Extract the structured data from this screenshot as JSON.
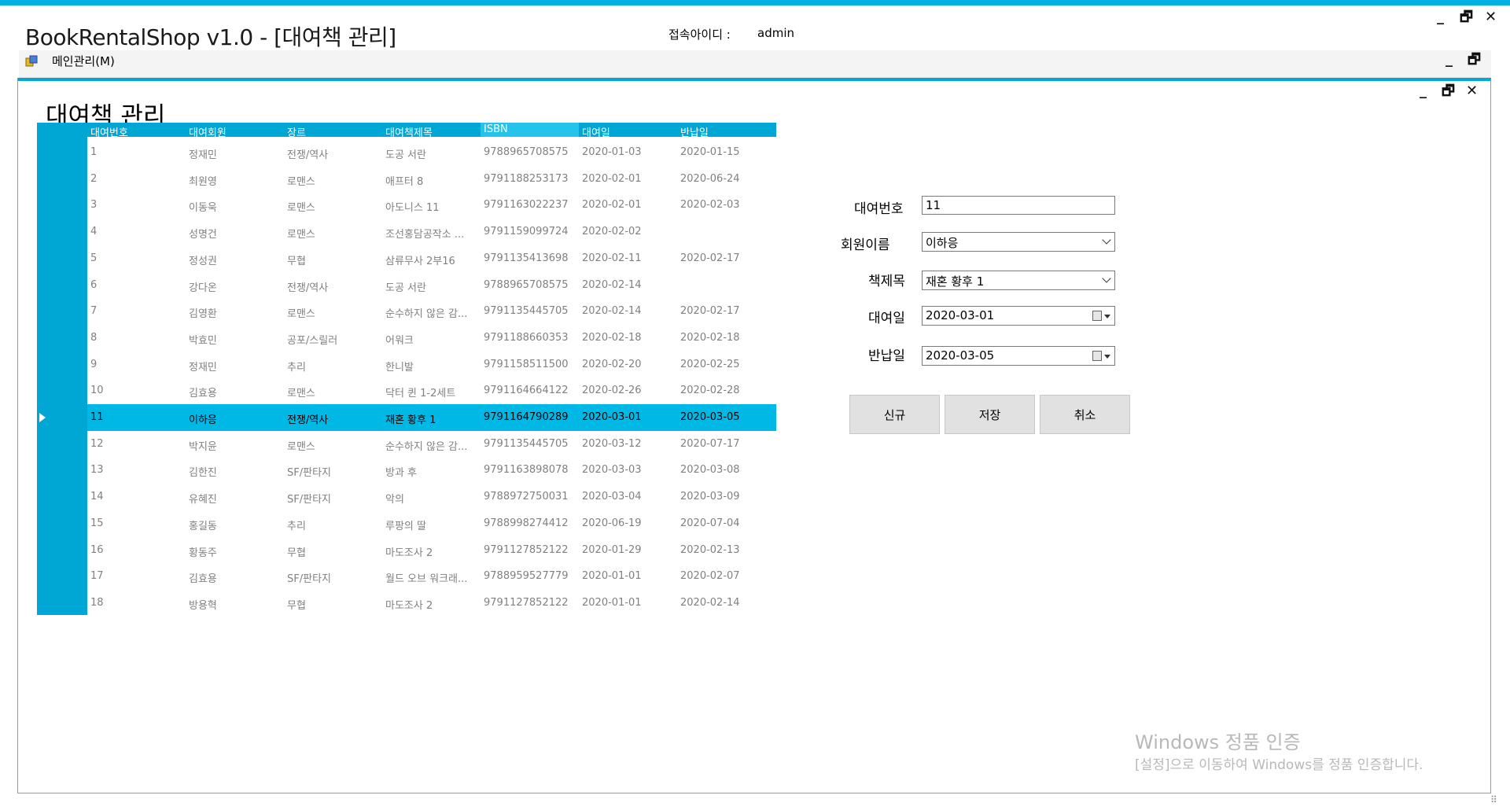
{
  "window": {
    "title": "BookRentalShop v1.0 - [대여책 관리]",
    "user_label": "접속아이디 :",
    "user_value": "admin"
  },
  "menubar": {
    "items": [
      {
        "label": "메인관리(M)"
      }
    ]
  },
  "form": {
    "title": "대여책 관리"
  },
  "grid": {
    "columns": [
      "대여번호",
      "대여회원",
      "장르",
      "대여책제목",
      "ISBN",
      "대여일",
      "반납일"
    ],
    "selected_row": 11,
    "rows": [
      {
        "no": "1",
        "member": "정재민",
        "genre": "전쟁/역사",
        "title": "도공 서란",
        "isbn": "9788965708575",
        "rent": "2020-01-03",
        "ret": "2020-01-15"
      },
      {
        "no": "2",
        "member": "최원영",
        "genre": "로맨스",
        "title": "애프터 8",
        "isbn": "9791188253173",
        "rent": "2020-02-01",
        "ret": "2020-06-24"
      },
      {
        "no": "3",
        "member": "이동욱",
        "genre": "로맨스",
        "title": "아도니스 11",
        "isbn": "9791163022237",
        "rent": "2020-02-01",
        "ret": "2020-02-03"
      },
      {
        "no": "4",
        "member": "성명건",
        "genre": "로맨스",
        "title": "조선홍담공작소 ...",
        "isbn": "9791159099724",
        "rent": "2020-02-02",
        "ret": ""
      },
      {
        "no": "5",
        "member": "정성권",
        "genre": "무협",
        "title": "삼류무사 2부16",
        "isbn": "9791135413698",
        "rent": "2020-02-11",
        "ret": "2020-02-17"
      },
      {
        "no": "6",
        "member": "강다온",
        "genre": "전쟁/역사",
        "title": "도공 서란",
        "isbn": "9788965708575",
        "rent": "2020-02-14",
        "ret": ""
      },
      {
        "no": "7",
        "member": "김영환",
        "genre": "로맨스",
        "title": "순수하지 않은 감...",
        "isbn": "9791135445705",
        "rent": "2020-02-14",
        "ret": "2020-02-17"
      },
      {
        "no": "8",
        "member": "박효민",
        "genre": "공포/스릴러",
        "title": "어워크",
        "isbn": "9791188660353",
        "rent": "2020-02-18",
        "ret": "2020-02-18"
      },
      {
        "no": "9",
        "member": "정재민",
        "genre": "추리",
        "title": "한니발",
        "isbn": "9791158511500",
        "rent": "2020-02-20",
        "ret": "2020-02-25"
      },
      {
        "no": "10",
        "member": "김효용",
        "genre": "로맨스",
        "title": "닥터 퀸 1-2세트",
        "isbn": "9791164664122",
        "rent": "2020-02-26",
        "ret": "2020-02-28"
      },
      {
        "no": "11",
        "member": "이하응",
        "genre": "전쟁/역사",
        "title": "재혼 황후 1",
        "isbn": "9791164790289",
        "rent": "2020-03-01",
        "ret": "2020-03-05"
      },
      {
        "no": "12",
        "member": "박지윤",
        "genre": "로맨스",
        "title": "순수하지 않은 감...",
        "isbn": "9791135445705",
        "rent": "2020-03-12",
        "ret": "2020-07-17"
      },
      {
        "no": "13",
        "member": "김한진",
        "genre": "SF/판타지",
        "title": "방과 후",
        "isbn": "9791163898078",
        "rent": "2020-03-03",
        "ret": "2020-03-08"
      },
      {
        "no": "14",
        "member": "유혜진",
        "genre": "SF/판타지",
        "title": "악의",
        "isbn": "9788972750031",
        "rent": "2020-03-04",
        "ret": "2020-03-09"
      },
      {
        "no": "15",
        "member": "홍길동",
        "genre": "추리",
        "title": "루팡의 딸",
        "isbn": "9788998274412",
        "rent": "2020-06-19",
        "ret": "2020-07-04"
      },
      {
        "no": "16",
        "member": "황동주",
        "genre": "무협",
        "title": "마도조사 2",
        "isbn": "9791127852122",
        "rent": "2020-01-29",
        "ret": "2020-02-13"
      },
      {
        "no": "17",
        "member": "김효용",
        "genre": "SF/판타지",
        "title": "월드 오브 워크래...",
        "isbn": "9788959527779",
        "rent": "2020-01-01",
        "ret": "2020-02-07"
      },
      {
        "no": "18",
        "member": "방용혁",
        "genre": "무협",
        "title": "마도조사 2",
        "isbn": "9791127852122",
        "rent": "2020-01-01",
        "ret": "2020-02-14"
      }
    ]
  },
  "detail": {
    "rental_no_label": "대여번호",
    "rental_no_value": "11",
    "member_label": "회원이름",
    "member_value": "이하응",
    "book_label": "책제목",
    "book_value": "재혼 황후 1",
    "rent_date_label": "대여일",
    "rent_date_value": "2020-03-01",
    "return_date_label": "반납일",
    "return_date_value": "2020-03-05"
  },
  "buttons": {
    "new_label": "신규",
    "save_label": "저장",
    "cancel_label": "취소"
  },
  "watermark": {
    "line1": "Windows 정품 인증",
    "line2": "[설정]으로 이동하여 Windows를 정품 인증합니다."
  },
  "colors": {
    "accent": "#00a6d4",
    "selected_row": "#00b8e6",
    "grid_text": "#808080"
  }
}
